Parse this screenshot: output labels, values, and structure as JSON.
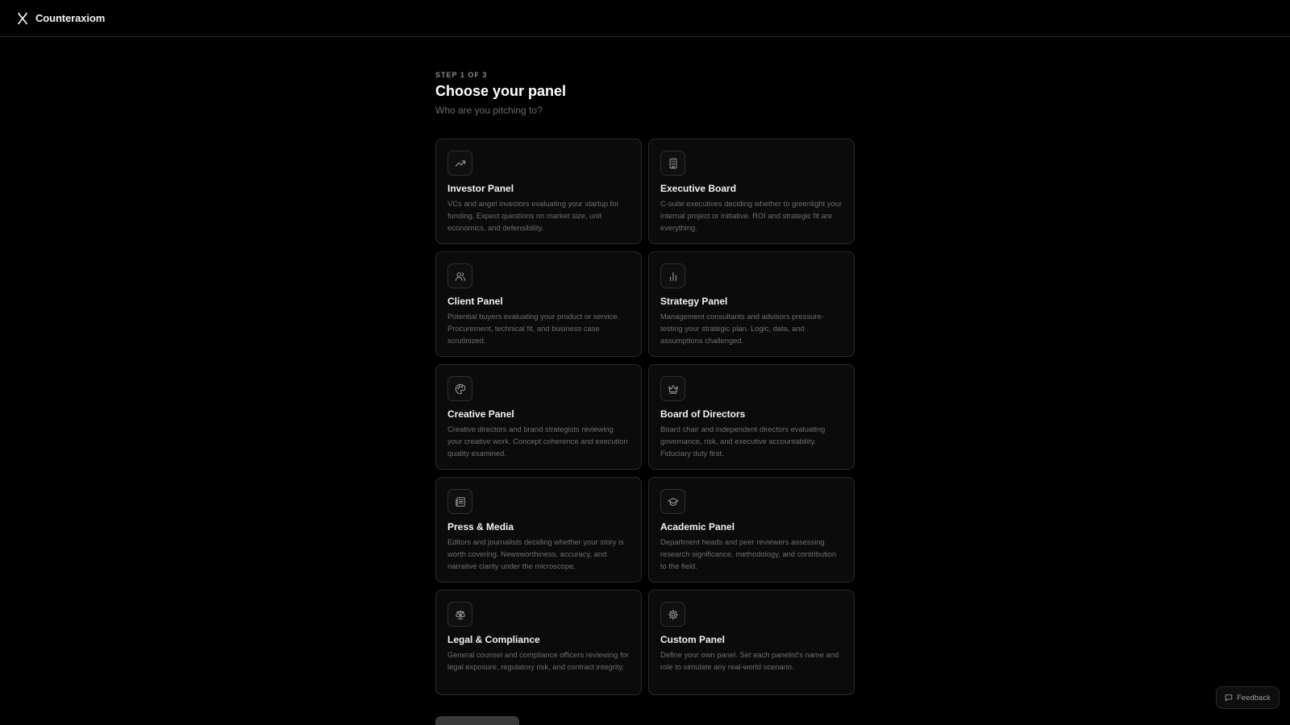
{
  "app": {
    "name": "Counteraxiom",
    "logo_icon": "x-logo-icon"
  },
  "header": {
    "step": "STEP 1 OF 3",
    "title": "Choose your panel",
    "subtitle": "Who are you pitching to?"
  },
  "panels": [
    {
      "icon": "trending-up-icon",
      "title": "Investor Panel",
      "description": "VCs and angel investors evaluating your startup for funding. Expect questions on market size, unit economics, and defensibility."
    },
    {
      "icon": "building-icon",
      "title": "Executive Board",
      "description": "C-suite executives deciding whether to greenlight your internal project or initiative. ROI and strategic fit are everything."
    },
    {
      "icon": "users-icon",
      "title": "Client Panel",
      "description": "Potential buyers evaluating your product or service. Procurement, technical fit, and business case scrutinized."
    },
    {
      "icon": "bar-chart-icon",
      "title": "Strategy Panel",
      "description": "Management consultants and advisors pressure-testing your strategic plan. Logic, data, and assumptions challenged."
    },
    {
      "icon": "palette-icon",
      "title": "Creative Panel",
      "description": "Creative directors and brand strategists reviewing your creative work. Concept coherence and execution quality examined."
    },
    {
      "icon": "crown-icon",
      "title": "Board of Directors",
      "description": "Board chair and independent directors evaluating governance, risk, and executive accountability. Fiduciary duty first."
    },
    {
      "icon": "newspaper-icon",
      "title": "Press & Media",
      "description": "Editors and journalists deciding whether your story is worth covering. Newsworthiness, accuracy, and narrative clarity under the microscope."
    },
    {
      "icon": "graduation-cap-icon",
      "title": "Academic Panel",
      "description": "Department heads and peer reviewers assessing research significance, methodology, and contribution to the field."
    },
    {
      "icon": "scale-icon",
      "title": "Legal & Compliance",
      "description": "General counsel and compliance officers reviewing for legal exposure, regulatory risk, and contract integrity."
    },
    {
      "icon": "gear-icon",
      "title": "Custom Panel",
      "description": "Define your own panel. Set each panelist's name and role to simulate any real-world scenario."
    }
  ],
  "feedback": {
    "label": "Feedback",
    "icon": "message-square-icon"
  },
  "colors": {
    "background": "#000000",
    "card_background": "#0b0b0b",
    "card_border": "#2a2a2a",
    "text_primary": "#ffffff",
    "text_muted": "#6e6e6e"
  }
}
